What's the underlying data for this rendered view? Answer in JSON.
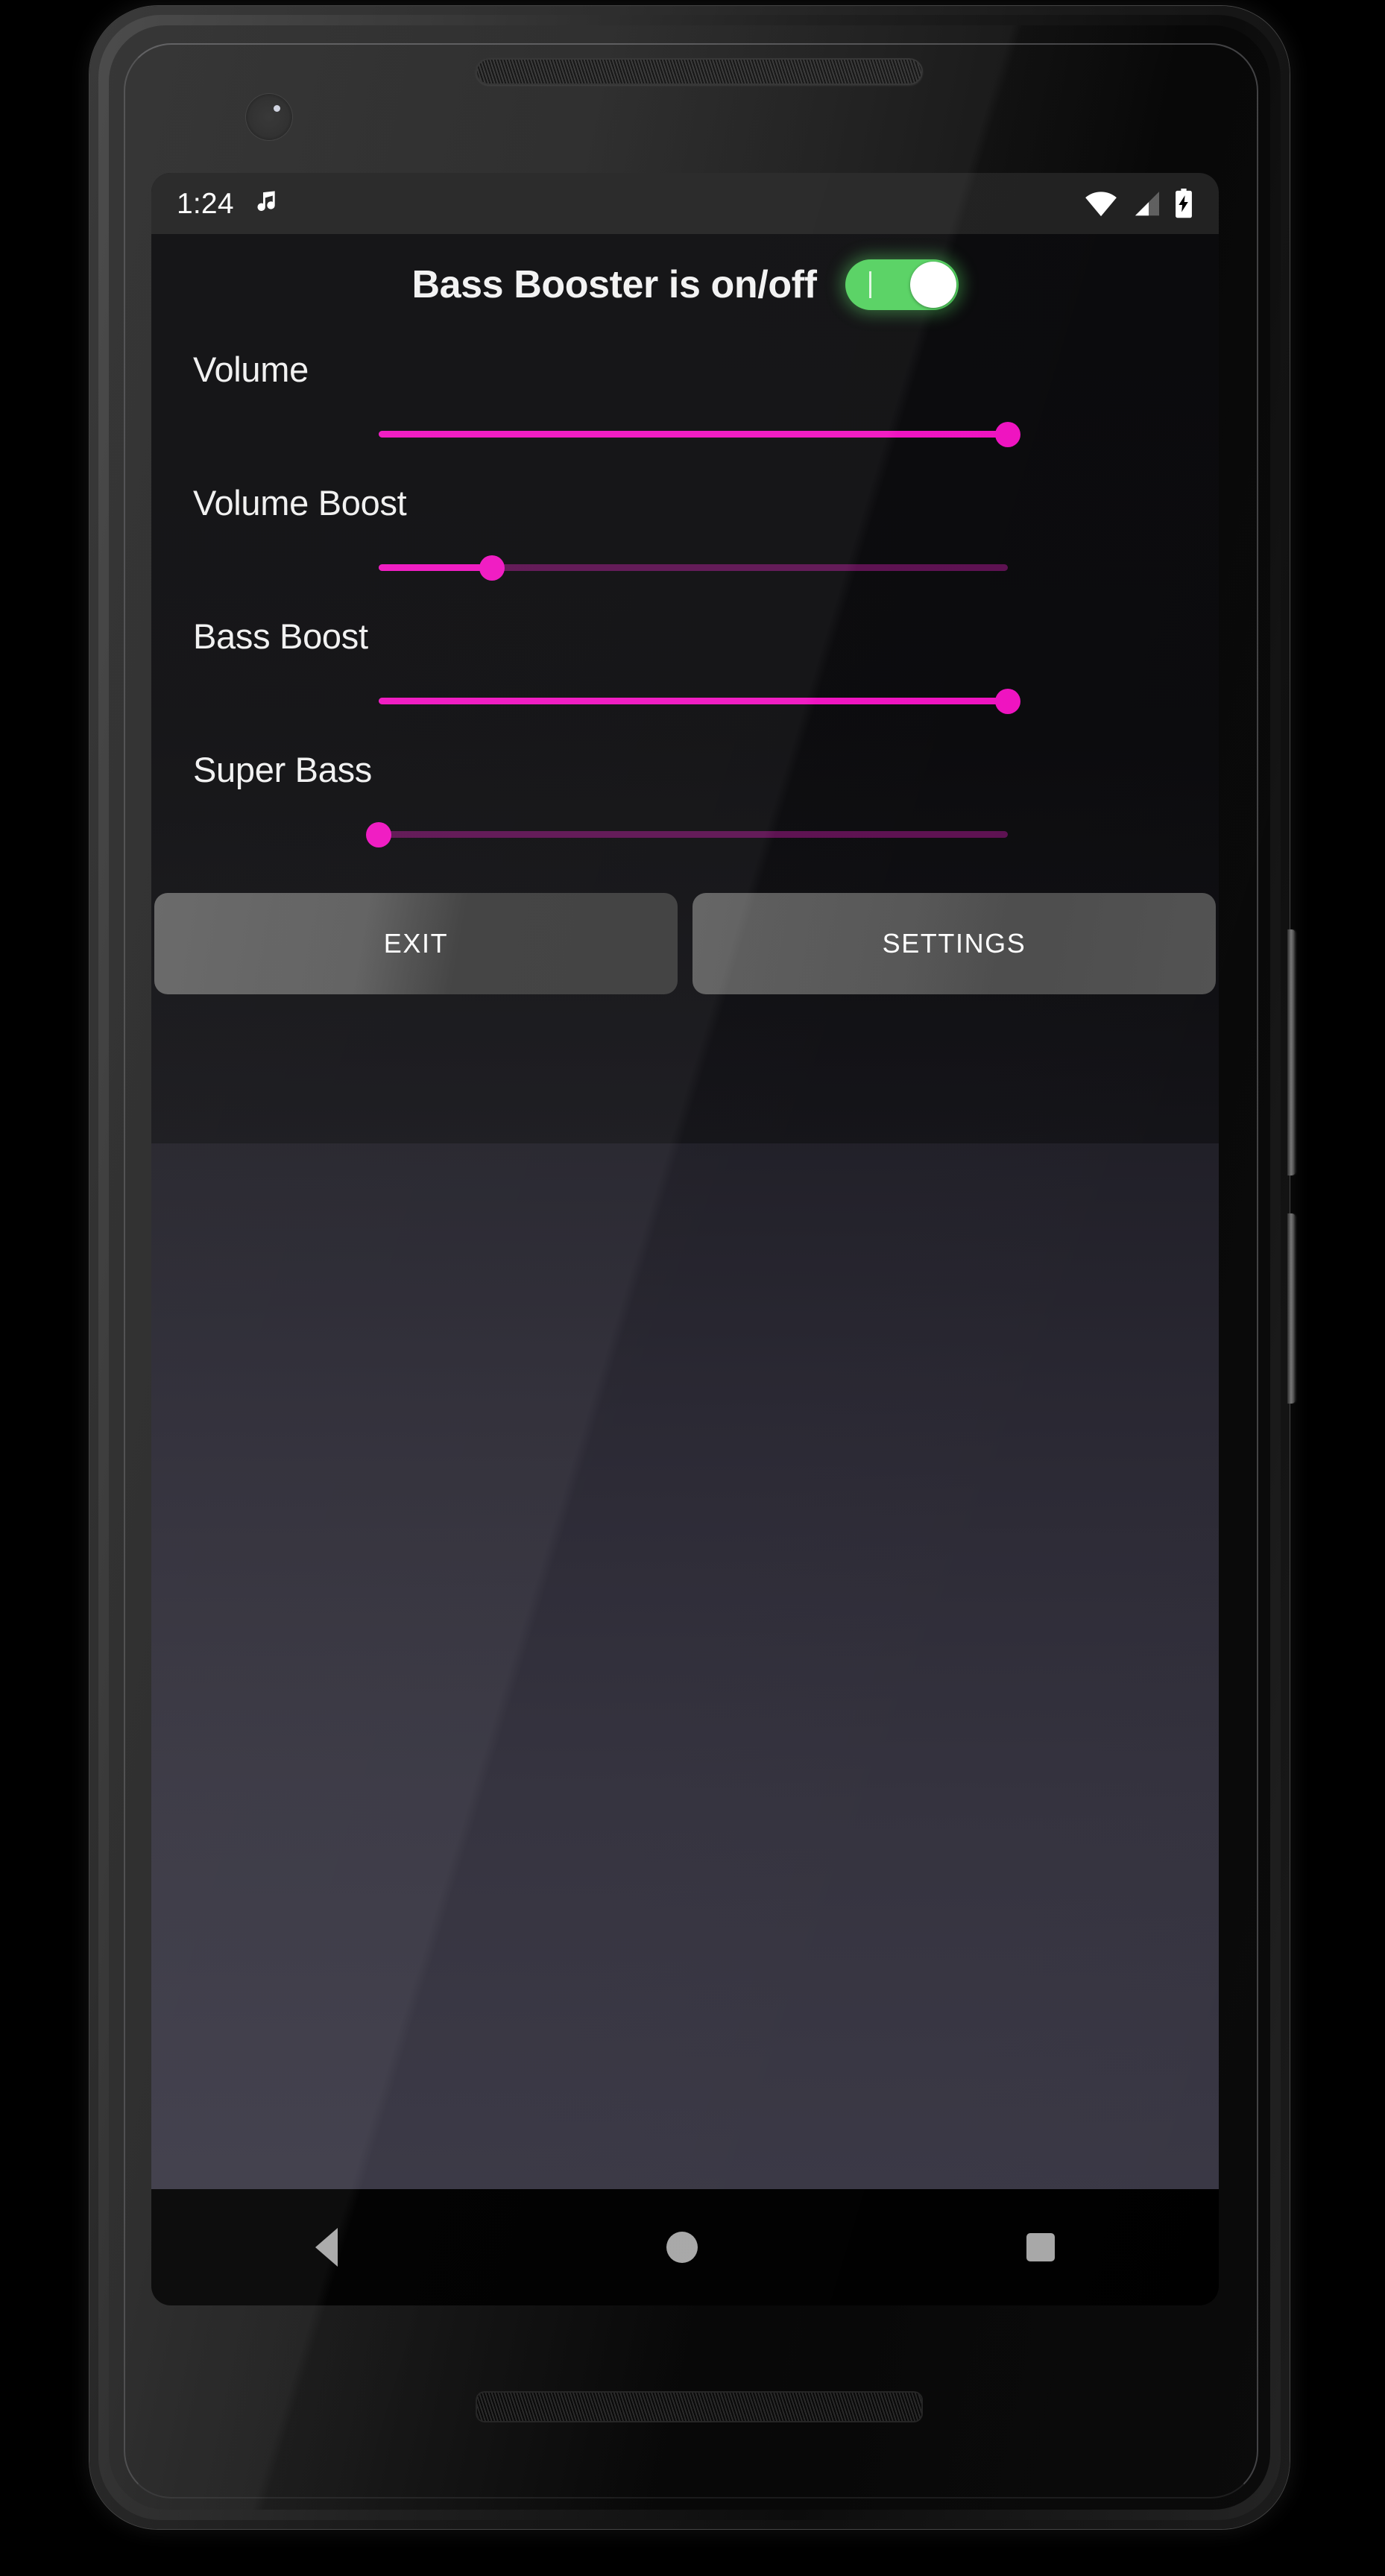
{
  "device": {
    "hardware": {
      "earpiece": "earpiece-speaker",
      "front_camera": "front-camera",
      "bottom_speaker": "bottom-speaker",
      "power_button": "power-button",
      "volume_button": "volume-button"
    }
  },
  "status_bar": {
    "clock": "1:24",
    "left_icons": [
      "music-note-icon"
    ],
    "right_icons": [
      "wifi-icon",
      "cellular-signal-icon",
      "battery-charging-icon"
    ]
  },
  "app": {
    "title": "Bass Booster is on/off",
    "power_toggle": {
      "name": "bass-booster-power-toggle",
      "state": "on",
      "color": "#53d15f"
    },
    "accent_color": "#ef12c0",
    "track_inactive_color": "#5c1050",
    "sliders": [
      {
        "label": "Volume",
        "value": 100,
        "min": 0,
        "max": 100
      },
      {
        "label": "Volume Boost",
        "value": 18,
        "min": 0,
        "max": 100
      },
      {
        "label": "Bass Boost",
        "value": 100,
        "min": 0,
        "max": 100
      },
      {
        "label": "Super Bass",
        "value": 0,
        "min": 0,
        "max": 100
      }
    ],
    "buttons": [
      {
        "label": "EXIT",
        "name": "exit-button"
      },
      {
        "label": "SETTINGS",
        "name": "settings-button"
      }
    ]
  },
  "nav_bar": {
    "items": [
      {
        "name": "nav-back-button",
        "icon": "triangle-back-icon"
      },
      {
        "name": "nav-home-button",
        "icon": "circle-home-icon"
      },
      {
        "name": "nav-recents-button",
        "icon": "square-recents-icon"
      }
    ]
  }
}
